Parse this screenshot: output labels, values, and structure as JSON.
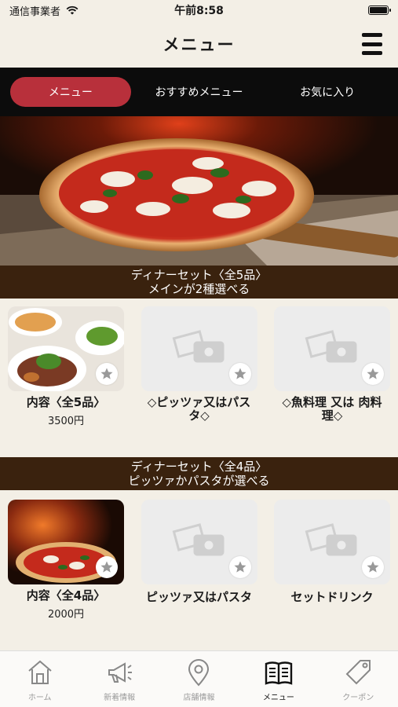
{
  "status_bar": {
    "carrier": "通信事業者",
    "time": "午前8:58"
  },
  "header": {
    "title": "メニュー"
  },
  "tabs": [
    {
      "label": "メニュー",
      "active": true
    },
    {
      "label": "おすすめメニュー",
      "active": false
    },
    {
      "label": "お気に入り",
      "active": false
    }
  ],
  "sections": [
    {
      "title_line1": "ディナーセット〈全5品〉",
      "title_line2": "メインが2種選べる",
      "items": [
        {
          "name": "内容〈全5品〉",
          "price": "3500円",
          "image": "dinner-plates"
        },
        {
          "name": "◇ピッツァ又はパスタ◇",
          "price": "",
          "image": "placeholder"
        },
        {
          "name": "◇魚料理 又は 肉料理◇",
          "price": "",
          "image": "placeholder"
        }
      ]
    },
    {
      "title_line1": "ディナーセット〈全4品〉",
      "title_line2": "ピッツァかパスタが選べる",
      "items": [
        {
          "name": "内容〈全4品〉",
          "price": "2000円",
          "image": "pizza-oven"
        },
        {
          "name": "ピッツァ又はパスタ",
          "price": "",
          "image": "placeholder"
        },
        {
          "name": "セットドリンク",
          "price": "",
          "image": "placeholder"
        }
      ]
    }
  ],
  "bottom_nav": [
    {
      "label": "ホーム",
      "icon": "home-icon",
      "active": false
    },
    {
      "label": "新着情報",
      "icon": "megaphone-icon",
      "active": false
    },
    {
      "label": "店舗情報",
      "icon": "map-pin-icon",
      "active": false
    },
    {
      "label": "メニュー",
      "icon": "book-icon",
      "active": true
    },
    {
      "label": "クーポン",
      "icon": "coupon-tag-icon",
      "active": false
    }
  ],
  "colors": {
    "accent": "#b8303b",
    "band": "#3a220e",
    "background": "#f3efe6"
  }
}
